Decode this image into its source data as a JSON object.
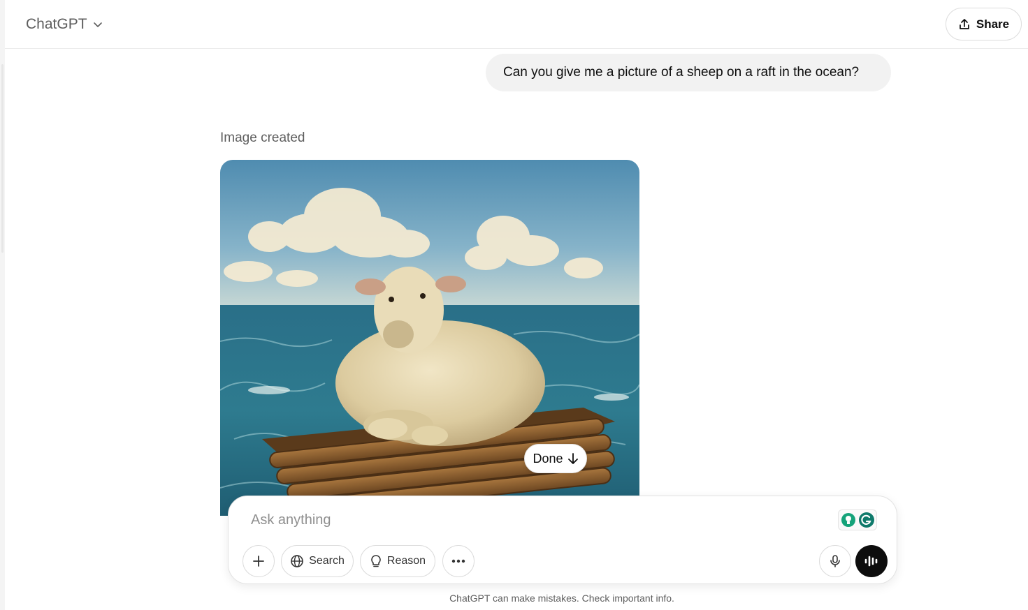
{
  "header": {
    "model_name": "ChatGPT",
    "share_label": "Share"
  },
  "conversation": {
    "user_message": "Can you give me a picture of a sheep on a raft in the ocean?",
    "assistant_status": "Image created",
    "image_subject": "sheep on a wooden raft in the ocean, painted style",
    "done_label": "Done"
  },
  "composer": {
    "placeholder": "Ask anything",
    "tools": [
      {
        "label": "Search",
        "icon": "globe-icon"
      },
      {
        "label": "Reason",
        "icon": "lightbulb-icon"
      }
    ]
  },
  "footer": {
    "disclaimer": "ChatGPT can make mistakes. Check important info."
  },
  "colors": {
    "bubble_bg": "#f2f2f2",
    "voice_button": "#0d0d0d",
    "grammarly_green": "#15a37a",
    "grammarly_teal": "#0f7a6b"
  }
}
